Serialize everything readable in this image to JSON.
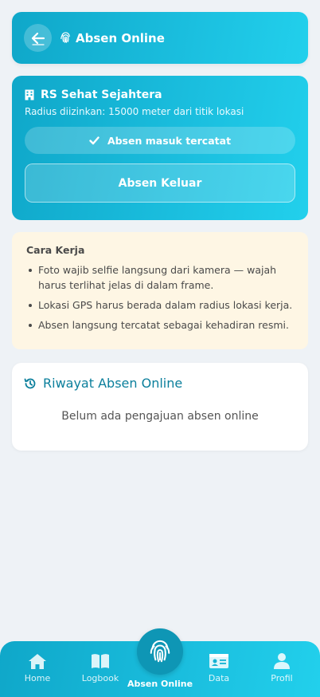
{
  "header": {
    "title": "Absen Online",
    "icons": {
      "back": "arrow-left-icon",
      "title": "fingerprint-icon"
    }
  },
  "location": {
    "name": "RS Sehat Sejahtera",
    "radius_text": "Radius diizinkan: 15000 meter dari titik lokasi",
    "status_text": "Absen masuk tercatat",
    "checkout_label": "Absen Keluar",
    "icons": {
      "name": "building-icon",
      "status": "check-icon"
    }
  },
  "info": {
    "title": "Cara Kerja",
    "items": [
      "Foto wajib selfie langsung dari kamera — wajah harus terlihat jelas di dalam frame.",
      "Lokasi GPS harus berada dalam radius lokasi kerja.",
      "Absen langsung tercatat sebagai kehadiran resmi."
    ]
  },
  "history": {
    "title": "Riwayat Absen Online",
    "empty_text": "Belum ada pengajuan absen online",
    "icon": "history-icon"
  },
  "nav": {
    "items": [
      {
        "label": "Home",
        "icon": "home-icon"
      },
      {
        "label": "Logbook",
        "icon": "book-icon"
      },
      {
        "label": "Absen Online",
        "icon": "fingerprint-icon",
        "active": true
      },
      {
        "label": "Data",
        "icon": "id-card-icon"
      },
      {
        "label": "Profil",
        "icon": "user-icon"
      }
    ]
  },
  "colors": {
    "primary": "#0fa7c9",
    "primary_light": "#22d0ec",
    "info_bg": "#fef6e4",
    "history_title": "#0b7f9c",
    "page_bg": "#eef2f6"
  }
}
